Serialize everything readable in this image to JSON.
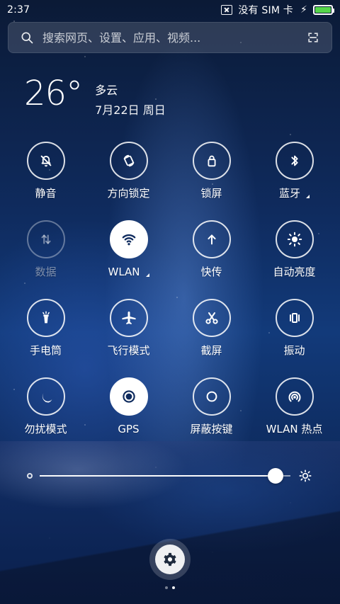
{
  "status_bar": {
    "time": "2:37",
    "sim_text": "没有 SIM 卡",
    "battery_level": 1.0,
    "battery_color": "#55d64a"
  },
  "search": {
    "placeholder": "搜索网页、设置、应用、视频..."
  },
  "weather": {
    "temperature": "26°",
    "condition": "多云",
    "date": "7月22日 周日"
  },
  "quick_toggles": [
    {
      "label": "静音",
      "icon": "bell-off-icon",
      "state": "off"
    },
    {
      "label": "方向锁定",
      "icon": "rotation-lock-icon",
      "state": "off"
    },
    {
      "label": "锁屏",
      "icon": "lock-icon",
      "state": "off"
    },
    {
      "label": "蓝牙",
      "icon": "bluetooth-icon",
      "state": "off",
      "has_submenu": true
    },
    {
      "label": "数据",
      "icon": "data-icon",
      "state": "disabled"
    },
    {
      "label": "WLAN",
      "icon": "wifi-icon",
      "state": "on",
      "has_submenu": true
    },
    {
      "label": "快传",
      "icon": "arrow-up-icon",
      "state": "off"
    },
    {
      "label": "自动亮度",
      "icon": "sun-icon",
      "state": "off"
    },
    {
      "label": "手电筒",
      "icon": "flashlight-icon",
      "state": "off"
    },
    {
      "label": "飞行模式",
      "icon": "airplane-icon",
      "state": "off"
    },
    {
      "label": "截屏",
      "icon": "scissors-icon",
      "state": "off"
    },
    {
      "label": "振动",
      "icon": "vibrate-icon",
      "state": "off"
    },
    {
      "label": "勿扰模式",
      "icon": "moon-icon",
      "state": "off"
    },
    {
      "label": "GPS",
      "icon": "gps-icon",
      "state": "on"
    },
    {
      "label": "屏蔽按键",
      "icon": "circle-icon",
      "state": "off"
    },
    {
      "label": "WLAN 热点",
      "icon": "hotspot-icon",
      "state": "off"
    }
  ],
  "brightness": {
    "value": 0.94
  },
  "bottom": {
    "settings_icon": "gear-icon",
    "pages_total": 2,
    "page_active": 2
  }
}
